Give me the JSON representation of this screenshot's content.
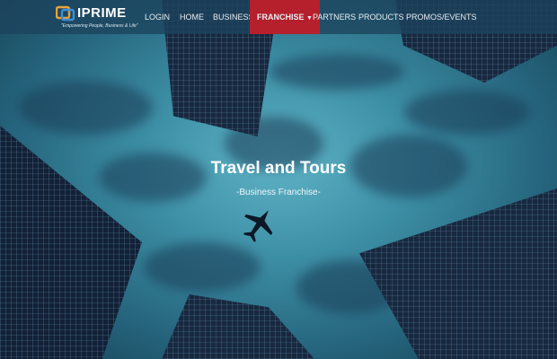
{
  "brand": {
    "name": "IPRIME",
    "tagline": "\"Empowering People, Business & Life\""
  },
  "nav": [
    {
      "label": "LOGIN"
    },
    {
      "label": "HOME"
    },
    {
      "label": "BUSINESS"
    },
    {
      "label": "FRANCHISE",
      "active": true,
      "has_dropdown": true
    },
    {
      "label": "PARTNERS"
    },
    {
      "label": "PRODUCTS"
    },
    {
      "label": "PROMOS/EVENTS"
    }
  ],
  "hero": {
    "title": "Travel and Tours",
    "subtitle": "-Business Franchise-"
  },
  "colors": {
    "navbar": "#1c425c",
    "active_nav": "#b5202c",
    "sky": "#3c8ea4",
    "text": "#ffffff"
  }
}
